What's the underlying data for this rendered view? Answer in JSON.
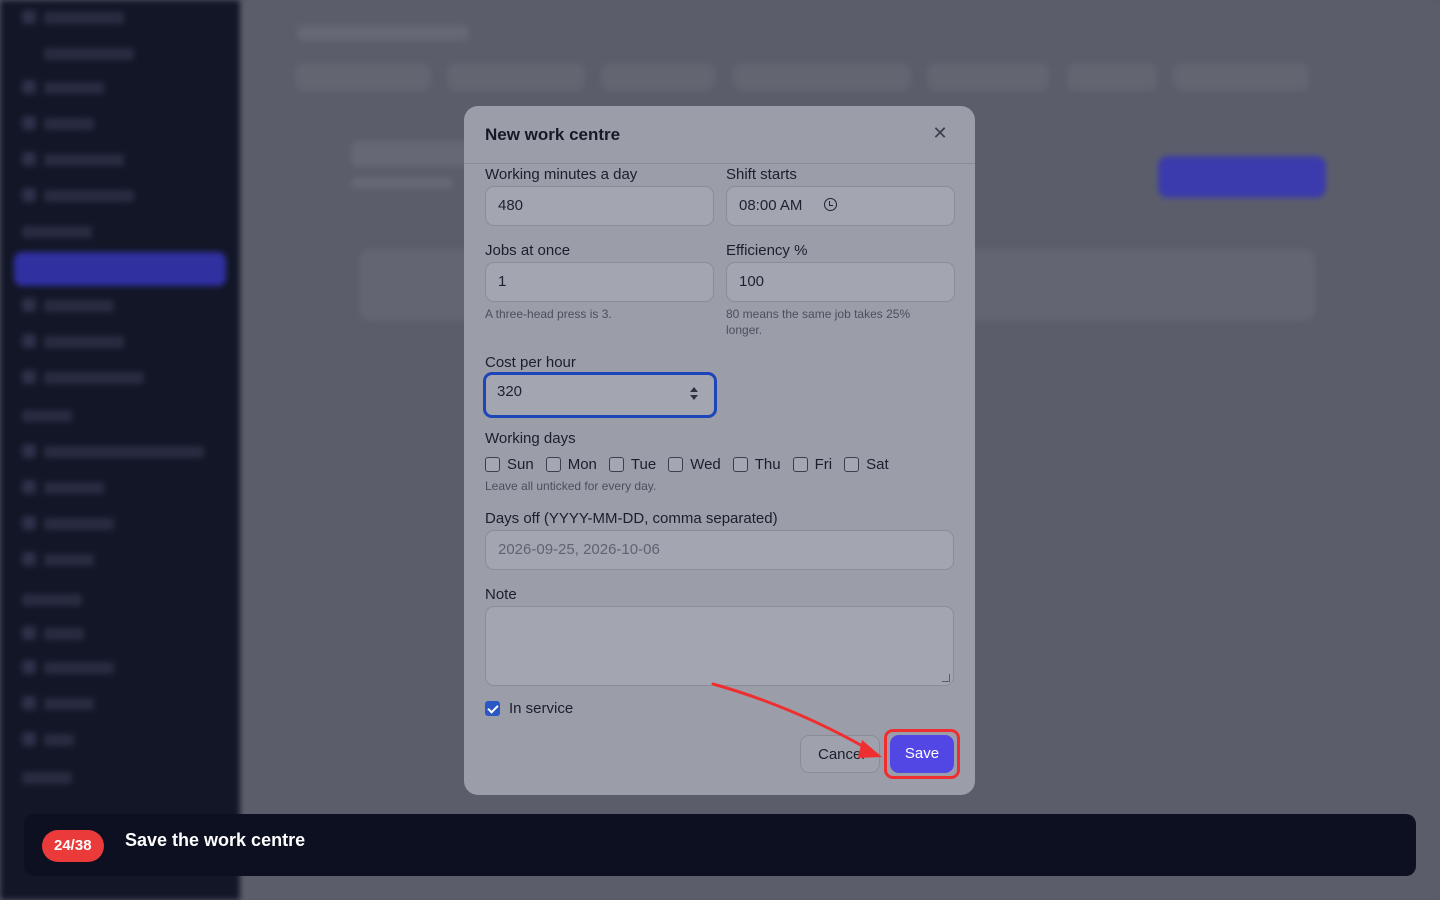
{
  "modal": {
    "title": "New work centre",
    "close_icon": "close-icon",
    "fields": {
      "working_minutes": {
        "label": "Working minutes a day",
        "value": "480"
      },
      "shift_starts": {
        "label": "Shift starts",
        "value": "08:00 AM"
      },
      "jobs_at_once": {
        "label": "Jobs at once",
        "value": "1",
        "hint": "A three-head press is 3."
      },
      "efficiency": {
        "label": "Efficiency %",
        "value": "100",
        "hint": "80 means the same job takes 25% longer."
      },
      "cost_per_hour": {
        "label": "Cost per hour",
        "value": "320"
      },
      "working_days": {
        "label": "Working days",
        "days": [
          "Sun",
          "Mon",
          "Tue",
          "Wed",
          "Thu",
          "Fri",
          "Sat"
        ],
        "hint": "Leave all unticked for every day."
      },
      "days_off": {
        "label": "Days off (YYYY-MM-DD, comma separated)",
        "placeholder": "2026-09-25, 2026-10-06"
      },
      "note": {
        "label": "Note",
        "value": ""
      },
      "in_service": {
        "label": "In service",
        "checked": true
      }
    },
    "buttons": {
      "cancel": "Cancel",
      "save": "Save"
    }
  },
  "banner": {
    "step": "24/38",
    "instruction": "Save the work centre"
  },
  "colors": {
    "accent": "#5246e4",
    "highlight": "#ef2f2f",
    "banner_bg": "#0c1020"
  }
}
